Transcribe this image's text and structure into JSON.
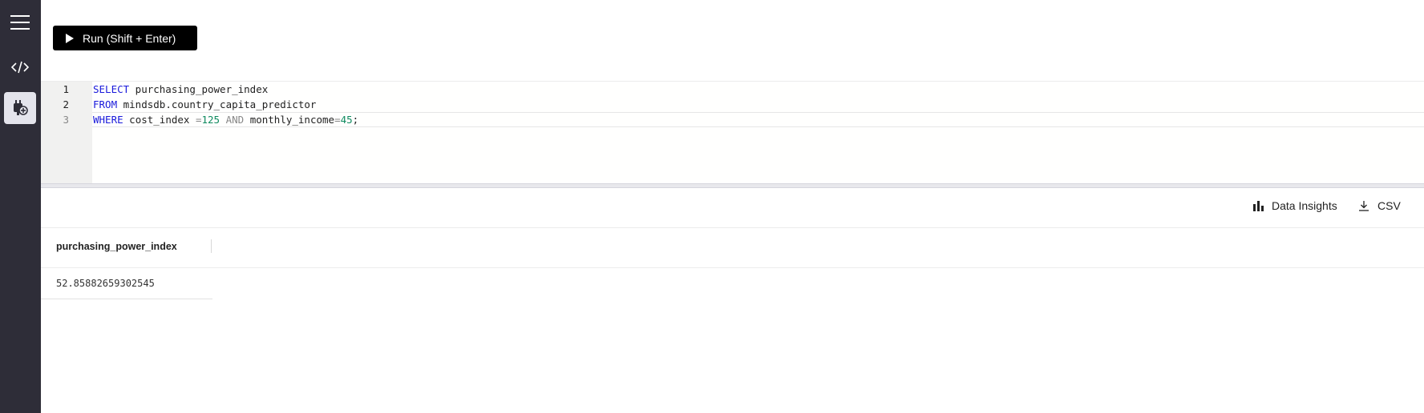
{
  "sidebar": {
    "items": [
      {
        "icon": "menu-icon"
      },
      {
        "icon": "code-icon"
      },
      {
        "icon": "plugin-icon",
        "active": true
      }
    ],
    "active_color": "#e4e4ec",
    "background": "#2e2d38"
  },
  "toolbar": {
    "run_label": "Run (Shift + Enter)"
  },
  "editor": {
    "lines": [
      {
        "number": "1",
        "tokens": [
          {
            "t": "SELECT",
            "c": "kw"
          },
          {
            "t": " purchasing_power_index",
            "c": "tx"
          }
        ]
      },
      {
        "number": "2",
        "tokens": [
          {
            "t": "FROM",
            "c": "kw"
          },
          {
            "t": " mindsdb.country_capita_predictor",
            "c": "tx"
          }
        ]
      },
      {
        "number": "3",
        "tokens": [
          {
            "t": "WHERE",
            "c": "kw"
          },
          {
            "t": " cost_index ",
            "c": "tx"
          },
          {
            "t": "=",
            "c": "op"
          },
          {
            "t": "125",
            "c": "num"
          },
          {
            "t": " ",
            "c": "tx"
          },
          {
            "t": "AND",
            "c": "op"
          },
          {
            "t": " monthly_income",
            "c": "tx"
          },
          {
            "t": "=",
            "c": "op"
          },
          {
            "t": "45",
            "c": "num"
          },
          {
            "t": ";",
            "c": "tx"
          }
        ]
      }
    ],
    "keyword_color": "#1a1adb",
    "number_color": "#0f8a5f"
  },
  "results": {
    "insights_label": "Data Insights",
    "csv_label": "CSV",
    "columns": [
      "purchasing_power_index"
    ],
    "rows": [
      [
        "52.85882659302545"
      ]
    ]
  }
}
